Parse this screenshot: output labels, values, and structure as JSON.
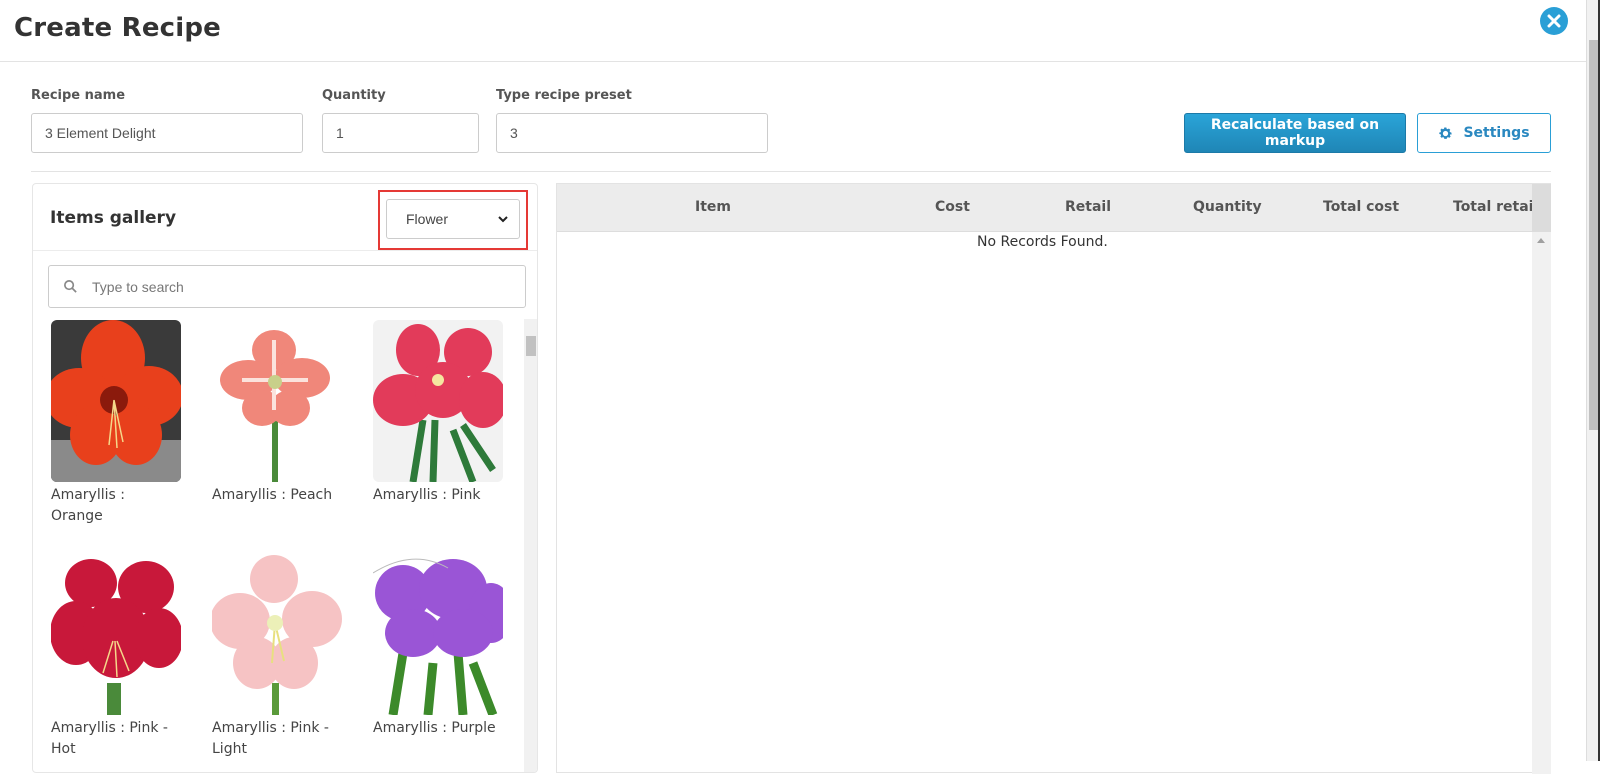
{
  "header": {
    "title": "Create Recipe"
  },
  "form": {
    "recipe_name_label": "Recipe name",
    "recipe_name_value": "3 Element Delight",
    "quantity_label": "Quantity",
    "quantity_value": "1",
    "preset_label": "Type recipe preset",
    "preset_value": "3",
    "recalc_label": "Recalculate based on markup",
    "settings_label": "Settings"
  },
  "gallery": {
    "title": "Items gallery",
    "category_selected": "Flower",
    "search_placeholder": "Type to search",
    "items": [
      {
        "name": "Amaryllis : Orange",
        "color": "#e8401c"
      },
      {
        "name": "Amaryllis : Peach",
        "color": "#f0877a"
      },
      {
        "name": "Amaryllis : Pink",
        "color": "#e23b5a"
      },
      {
        "name": "Amaryllis : Pink - Hot",
        "color": "#c8183a"
      },
      {
        "name": "Amaryllis : Pink - Light",
        "color": "#f6c3c4"
      },
      {
        "name": "Amaryllis : Purple",
        "color": "#9a55d6"
      }
    ]
  },
  "table": {
    "columns": [
      "Item",
      "Cost",
      "Retail",
      "Quantity",
      "Total cost",
      "Total retai"
    ],
    "empty_message": "No Records Found."
  },
  "colors": {
    "accent": "#2a9fd6",
    "highlight": "#e53935"
  }
}
